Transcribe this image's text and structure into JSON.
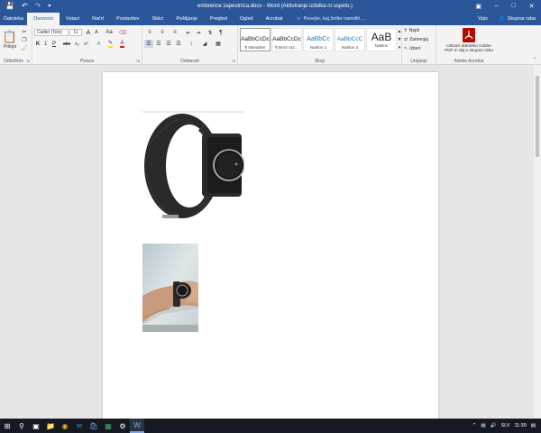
{
  "window": {
    "title": "embrence zapestnica.docx - Word (Aktiviranje izdelka ni uspelo.)",
    "qa_icons": [
      "save-icon",
      "undo-icon",
      "redo-icon",
      "customize-icon"
    ]
  },
  "tabs": {
    "items": [
      {
        "label": "Datoteka",
        "id": "file"
      },
      {
        "label": "Osnovno",
        "id": "home"
      },
      {
        "label": "Vstavi",
        "id": "insert"
      },
      {
        "label": "Načrt",
        "id": "design"
      },
      {
        "label": "Postavitev",
        "id": "layout"
      },
      {
        "label": "Sklici",
        "id": "references"
      },
      {
        "label": "Pošiljanje",
        "id": "mailings"
      },
      {
        "label": "Pregled",
        "id": "review"
      },
      {
        "label": "Ogled",
        "id": "view"
      },
      {
        "label": "Acrobat",
        "id": "acrobat"
      }
    ],
    "active": "home",
    "tell_me": "Povejte, kaj želite narediti ...",
    "sign_in": "Vpis",
    "share": "Skupna raba"
  },
  "ribbon": {
    "clipboard": {
      "paste_label": "Prilepi",
      "group_label": "Odložišče"
    },
    "font": {
      "name": "Calibri (Telo)",
      "size": "11",
      "group_label": "Pisava",
      "bold": "K",
      "italic": "Ľ",
      "underline": "P",
      "strike": "abc",
      "sub": "x₂",
      "sup": "x²",
      "grow": "A",
      "shrink": "A",
      "case": "Aa"
    },
    "paragraph": {
      "group_label": "Odstavek",
      "pilcrow": "¶"
    },
    "styles": {
      "group_label": "Slogi",
      "items": [
        {
          "preview": "AaBbCcDc",
          "name": "¶ Navaden",
          "selected": true
        },
        {
          "preview": "AaBbCcDc",
          "name": "¶ Brez raz...",
          "selected": false
        },
        {
          "preview": "AaBbCc",
          "name": "Naslov 1",
          "selected": false
        },
        {
          "preview": "AaBbCcC",
          "name": "Naslov 2",
          "selected": false
        },
        {
          "preview": "AaB",
          "name": "Naslov",
          "selected": false
        }
      ]
    },
    "editing": {
      "group_label": "Urejanje",
      "find": "Najdi",
      "replace": "Zamenjaj",
      "select": "Izberi"
    },
    "acrobat": {
      "line1": "Ustvari datoteko Adobe",
      "line2": "PDF in daj v skupno rabo",
      "group_label": "Adobe Acrobat"
    }
  },
  "taskbar": {
    "apps": [
      "start-icon",
      "search-icon",
      "task-view-icon",
      "file-explorer-icon",
      "chrome-icon",
      "outlook-icon",
      "store-icon",
      "excel-icon",
      "settings-icon",
      "word-icon"
    ],
    "lang": "SLV",
    "time": "11:39"
  },
  "colors": {
    "accent": "#2b579a",
    "taskbar": "#151a22"
  }
}
